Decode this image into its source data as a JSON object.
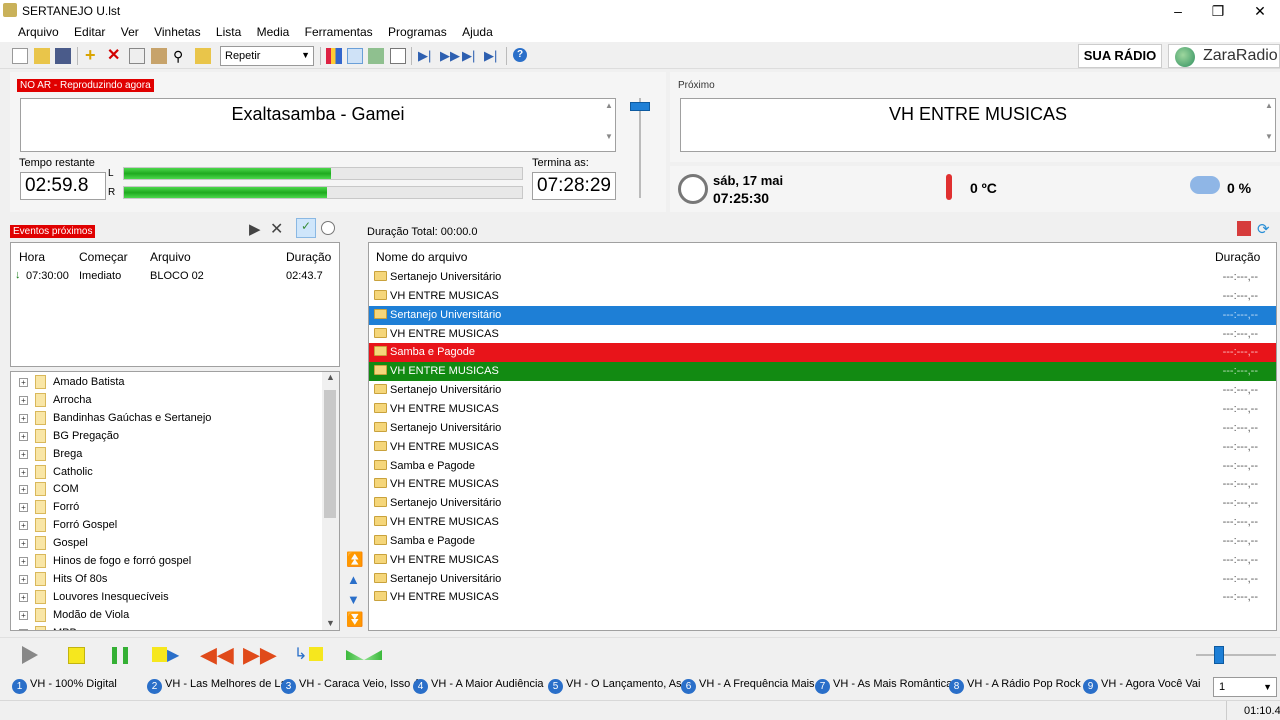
{
  "window": {
    "title": "SERTANEJO U.lst"
  },
  "menu": [
    "Arquivo",
    "Editar",
    "Ver",
    "Vinhetas",
    "Lista",
    "Media",
    "Ferramentas",
    "Programas",
    "Ajuda"
  ],
  "toolbar": {
    "mode": "Repetir",
    "brand_station": "SUA RÁDIO",
    "brand_app": "ZaraRadio"
  },
  "on_air": {
    "label": "NO AR - Reproduzindo agora",
    "track": "Exaltasamba - Gamei",
    "remaining_label": "Tempo restante",
    "remaining": "02:59.8",
    "ends_label": "Termina as:",
    "ends": "07:28:29",
    "level_left_label": "L",
    "level_right_label": "R",
    "level_left": 0.52,
    "level_right": 0.51
  },
  "next": {
    "label": "Próximo",
    "track": "VH  ENTRE MUSICAS"
  },
  "status": {
    "date": "sáb, 17 mai",
    "time": "07:25:30",
    "temperature": "0 ºC",
    "humidity": "0 %"
  },
  "events": {
    "label": "Eventos próximos",
    "columns": [
      "Hora",
      "Começar",
      "Arquivo",
      "Duração"
    ],
    "rows": [
      {
        "hora": "07:30:00",
        "comecar": "Imediato",
        "arquivo": "BLOCO 02",
        "duracao": "02:43.7"
      }
    ]
  },
  "tree": [
    "Amado Batista",
    "Arrocha",
    "Bandinhas Gaúchas e Sertanejo",
    "BG Pregação",
    "Brega",
    "Catholic",
    "COM",
    "Forró",
    "Forró Gospel",
    "Gospel",
    "Hinos de fogo e forró gospel",
    "Hits Of 80s",
    "Louvores Inesquecíveis",
    "Modão de Viola",
    "MPB"
  ],
  "playlist": {
    "total_label": "Duração Total: 00:00.0",
    "col_name": "Nome do arquivo",
    "col_duration": "Duração",
    "rows": [
      {
        "name": "Sertanejo Universitário",
        "duration": "---:---,--",
        "state": "normal"
      },
      {
        "name": "VH  ENTRE MUSICAS",
        "duration": "---:---,--",
        "state": "normal"
      },
      {
        "name": "Sertanejo Universitário",
        "duration": "---:---,--",
        "state": "selected"
      },
      {
        "name": "VH  ENTRE MUSICAS",
        "duration": "---:---,--",
        "state": "normal"
      },
      {
        "name": "Samba e Pagode",
        "duration": "---:---,--",
        "state": "playing"
      },
      {
        "name": "VH  ENTRE MUSICAS",
        "duration": "---:---,--",
        "state": "next"
      },
      {
        "name": "Sertanejo Universitário",
        "duration": "---:---,--",
        "state": "normal"
      },
      {
        "name": "VH  ENTRE MUSICAS",
        "duration": "---:---,--",
        "state": "normal"
      },
      {
        "name": "Sertanejo Universitário",
        "duration": "---:---,--",
        "state": "normal"
      },
      {
        "name": "VH  ENTRE MUSICAS",
        "duration": "---:---,--",
        "state": "normal"
      },
      {
        "name": "Samba e Pagode",
        "duration": "---:---,--",
        "state": "normal"
      },
      {
        "name": "VH  ENTRE MUSICAS",
        "duration": "---:---,--",
        "state": "normal"
      },
      {
        "name": "Sertanejo Universitário",
        "duration": "---:---,--",
        "state": "normal"
      },
      {
        "name": "VH  ENTRE MUSICAS",
        "duration": "---:---,--",
        "state": "normal"
      },
      {
        "name": "Samba e Pagode",
        "duration": "---:---,--",
        "state": "normal"
      },
      {
        "name": "VH  ENTRE MUSICAS",
        "duration": "---:---,--",
        "state": "normal"
      },
      {
        "name": "Sertanejo Universitário",
        "duration": "---:---,--",
        "state": "normal"
      },
      {
        "name": "VH  ENTRE MUSICAS",
        "duration": "---:---,--",
        "state": "normal"
      }
    ]
  },
  "jingles": [
    {
      "num": "1",
      "label": "VH - 100% Digital"
    },
    {
      "num": "2",
      "label": "VH - Las Melhores de La"
    },
    {
      "num": "3",
      "label": "VH - Caraca Veio, Isso é"
    },
    {
      "num": "4",
      "label": "VH - A Maior Audiência"
    },
    {
      "num": "5",
      "label": "VH - O Lançamento, As"
    },
    {
      "num": "6",
      "label": "VH - A Frequência Mais"
    },
    {
      "num": "7",
      "label": "VH - As Mais Românticas"
    },
    {
      "num": "8",
      "label": "VH - A Rádio Pop Rock"
    },
    {
      "num": "9",
      "label": "VH - Agora Você Vai"
    }
  ],
  "jingle_page": "1",
  "statusbar": {
    "clock": "01:10.4"
  },
  "colors": {
    "selected": "#1e7fd6",
    "playing": "#e8141a",
    "next": "#128a12",
    "meter": "#22b822"
  }
}
